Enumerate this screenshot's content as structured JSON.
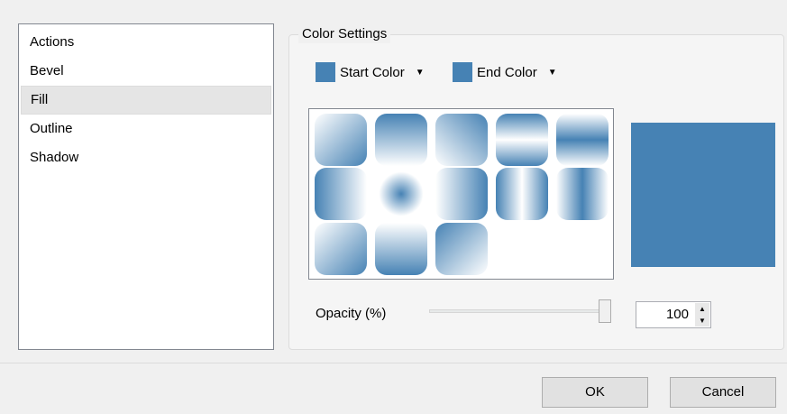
{
  "sidebar": {
    "items": [
      {
        "label": "Actions"
      },
      {
        "label": "Bevel"
      },
      {
        "label": "Fill",
        "selected": true
      },
      {
        "label": "Outline"
      },
      {
        "label": "Shadow"
      }
    ]
  },
  "color_settings": {
    "title": "Color Settings",
    "start_color_label": "Start Color",
    "end_color_label": "End Color",
    "start_color": "#4682b4",
    "end_color": "#4682b4",
    "preview_color": "#4682b4"
  },
  "opacity": {
    "label": "Opacity (%)",
    "value": "100",
    "slider_level": 1.0
  },
  "footer": {
    "ok_label": "OK",
    "cancel_label": "Cancel"
  }
}
